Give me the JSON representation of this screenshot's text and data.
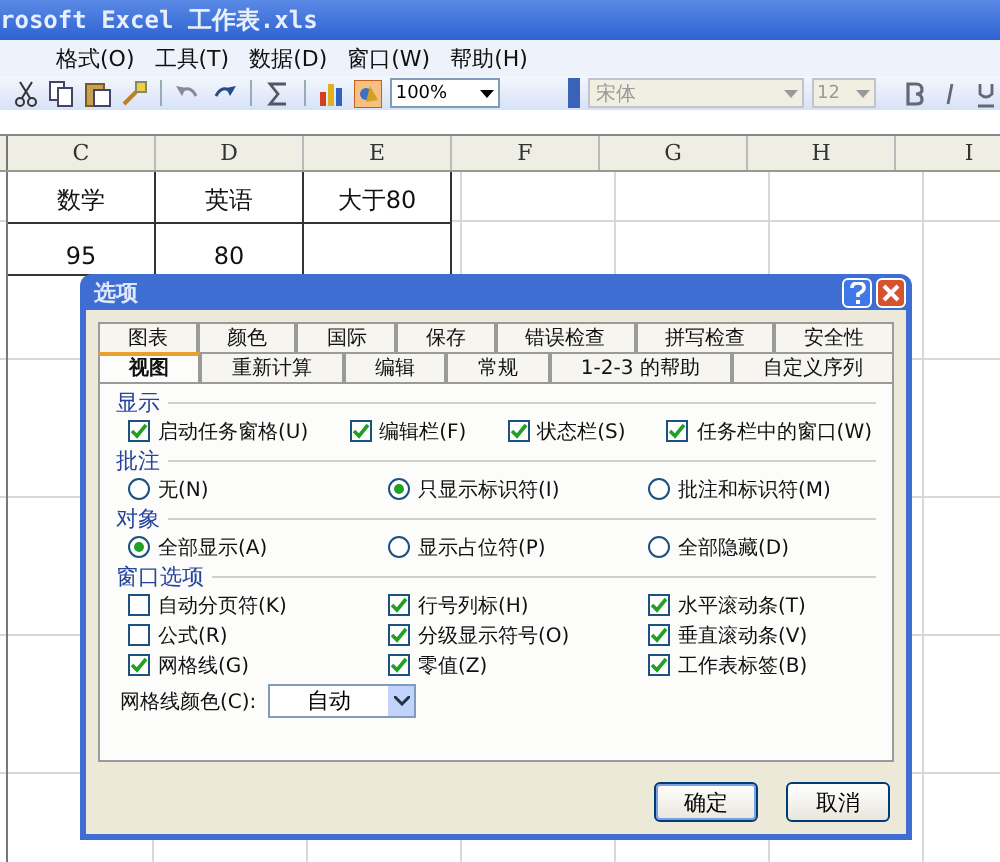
{
  "window": {
    "title": "rosoft Excel 工作表.xls"
  },
  "menu_bar": [
    "格式(O)",
    "工具(T)",
    "数据(D)",
    "窗口(W)",
    "帮助(H)"
  ],
  "toolbar": {
    "zoom": "100%",
    "font": "宋体",
    "font_size": "12"
  },
  "sheet": {
    "columns": [
      "C",
      "D",
      "E",
      "F",
      "G",
      "H",
      "I"
    ],
    "rows": [
      {
        "cells": [
          {
            "text": "数学",
            "bordered": true
          },
          {
            "text": "英语",
            "bordered": true
          },
          {
            "text": "大于80",
            "bordered": true
          }
        ]
      },
      {
        "cells": [
          {
            "text": "95",
            "bordered": true
          },
          {
            "text": "80",
            "bordered": true
          },
          {
            "bordered": true
          }
        ]
      }
    ]
  },
  "dialog": {
    "title": "选项",
    "tabs_back": [
      {
        "label": "图表",
        "selected": false
      },
      {
        "label": "颜色",
        "selected": false
      },
      {
        "label": "国际",
        "selected": false
      },
      {
        "label": "保存",
        "selected": false
      },
      {
        "label": "错误检查",
        "selected": false
      },
      {
        "label": "拼写检查",
        "selected": false
      },
      {
        "label": "安全性",
        "selected": false
      }
    ],
    "tabs_front": [
      {
        "label": "视图",
        "selected": true
      },
      {
        "label": "重新计算",
        "selected": false
      },
      {
        "label": "编辑",
        "selected": false
      },
      {
        "label": "常规",
        "selected": false
      },
      {
        "label": "1-2-3 的帮助",
        "selected": false
      },
      {
        "label": "自定义序列",
        "selected": false
      }
    ],
    "sections": [
      {
        "title": "显示",
        "kind": "checkbox",
        "items": [
          {
            "label": "启动任务窗格(U)",
            "checked": true
          },
          {
            "label": "编辑栏(F)",
            "checked": true
          },
          {
            "label": "状态栏(S)",
            "checked": true
          },
          {
            "label": "任务栏中的窗口(W)",
            "checked": true
          }
        ]
      },
      {
        "title": "批注",
        "kind": "radio",
        "items": [
          {
            "label": "无(N)",
            "selected": false
          },
          {
            "label": "只显示标识符(I)",
            "selected": true
          },
          {
            "label": "批注和标识符(M)",
            "selected": false
          }
        ]
      },
      {
        "title": "对象",
        "kind": "radio",
        "items": [
          {
            "label": "全部显示(A)",
            "selected": true
          },
          {
            "label": "显示占位符(P)",
            "selected": false
          },
          {
            "label": "全部隐藏(D)",
            "selected": false
          }
        ]
      },
      {
        "title": "窗口选项",
        "kind": "checkbox",
        "items": [
          {
            "label": "自动分页符(K)",
            "checked": false
          },
          {
            "label": "行号列标(H)",
            "checked": true
          },
          {
            "label": "水平滚动条(T)",
            "checked": true
          },
          {
            "label": "公式(R)",
            "checked": false
          },
          {
            "label": "分级显示符号(O)",
            "checked": true
          },
          {
            "label": "垂直滚动条(V)",
            "checked": true
          },
          {
            "label": "网格线(G)",
            "checked": true
          },
          {
            "label": "零值(Z)",
            "checked": true
          },
          {
            "label": "工作表标签(B)",
            "checked": true
          }
        ]
      }
    ],
    "gridline_color": {
      "label": "网格线颜色(C):",
      "value": "自动"
    },
    "buttons": [
      "确定",
      "取消"
    ]
  }
}
